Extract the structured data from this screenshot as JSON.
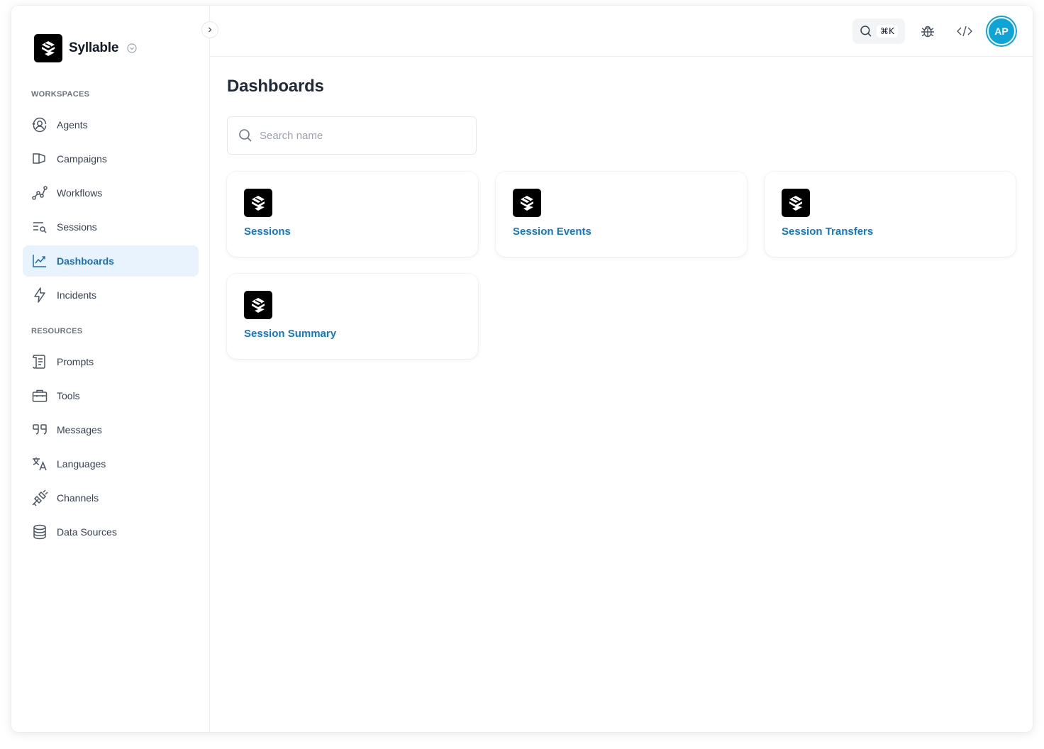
{
  "brand": {
    "name": "Syllable"
  },
  "sidebar": {
    "workspaces_label": "WORKSPACES",
    "resources_label": "RESOURCES",
    "workspaces": [
      {
        "label": "Agents",
        "icon": "agents-icon"
      },
      {
        "label": "Campaigns",
        "icon": "campaigns-icon"
      },
      {
        "label": "Workflows",
        "icon": "workflows-icon"
      },
      {
        "label": "Sessions",
        "icon": "sessions-icon"
      },
      {
        "label": "Dashboards",
        "icon": "dashboards-icon",
        "active": true
      },
      {
        "label": "Incidents",
        "icon": "incidents-icon"
      }
    ],
    "resources": [
      {
        "label": "Prompts",
        "icon": "prompts-icon"
      },
      {
        "label": "Tools",
        "icon": "tools-icon"
      },
      {
        "label": "Messages",
        "icon": "messages-icon"
      },
      {
        "label": "Languages",
        "icon": "languages-icon"
      },
      {
        "label": "Channels",
        "icon": "channels-icon"
      },
      {
        "label": "Data Sources",
        "icon": "data-sources-icon"
      }
    ]
  },
  "topbar": {
    "search_shortcut": "⌘K",
    "avatar_initials": "AP"
  },
  "main": {
    "title": "Dashboards",
    "search_placeholder": "Search name",
    "search_value": "",
    "cards": [
      {
        "title": "Sessions"
      },
      {
        "title": "Session Events"
      },
      {
        "title": "Session Transfers"
      },
      {
        "title": "Session Summary"
      }
    ]
  },
  "colors": {
    "accent": "#1377c5",
    "active_bg": "#e8f3fd",
    "avatar": "#0ea5d6"
  }
}
